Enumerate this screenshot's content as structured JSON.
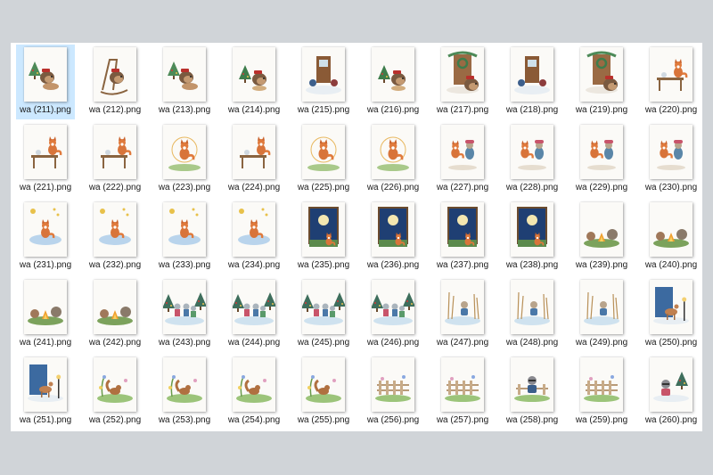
{
  "files": [
    {
      "name": "wa (211).png",
      "subject": "hedgehog-bowl",
      "selected": true
    },
    {
      "name": "wa (212).png",
      "subject": "hedgehog-rocking-chair"
    },
    {
      "name": "wa (213).png",
      "subject": "hedgehog-bowl"
    },
    {
      "name": "wa (214).png",
      "subject": "hedgehog-tree"
    },
    {
      "name": "wa (215).png",
      "subject": "doorway-snow"
    },
    {
      "name": "wa (216).png",
      "subject": "hedgehog-tree"
    },
    {
      "name": "wa (217).png",
      "subject": "doorway-wreath"
    },
    {
      "name": "wa (218).png",
      "subject": "doorway-snow"
    },
    {
      "name": "wa (219).png",
      "subject": "doorway-wreath"
    },
    {
      "name": "wa (220).png",
      "subject": "fox-table"
    },
    {
      "name": "wa (221).png",
      "subject": "fox-table"
    },
    {
      "name": "wa (222).png",
      "subject": "fox-table"
    },
    {
      "name": "wa (223).png",
      "subject": "fox-leaping"
    },
    {
      "name": "wa (224).png",
      "subject": "fox-table"
    },
    {
      "name": "wa (225).png",
      "subject": "fox-leaping"
    },
    {
      "name": "wa (226).png",
      "subject": "fox-leaping"
    },
    {
      "name": "wa (227).png",
      "subject": "animals-pair"
    },
    {
      "name": "wa (228).png",
      "subject": "animals-pair"
    },
    {
      "name": "wa (229).png",
      "subject": "animals-pair"
    },
    {
      "name": "wa (230).png",
      "subject": "animals-pair"
    },
    {
      "name": "wa (231).png",
      "subject": "fox-cloud"
    },
    {
      "name": "wa (232).png",
      "subject": "fox-cloud"
    },
    {
      "name": "wa (233).png",
      "subject": "fox-cloud"
    },
    {
      "name": "wa (234).png",
      "subject": "fox-cloud"
    },
    {
      "name": "wa (235).png",
      "subject": "night-window"
    },
    {
      "name": "wa (236).png",
      "subject": "night-window"
    },
    {
      "name": "wa (237).png",
      "subject": "night-window"
    },
    {
      "name": "wa (238).png",
      "subject": "night-window"
    },
    {
      "name": "wa (239).png",
      "subject": "campfire"
    },
    {
      "name": "wa (240).png",
      "subject": "campfire"
    },
    {
      "name": "wa (241).png",
      "subject": "campfire"
    },
    {
      "name": "wa (242).png",
      "subject": "campfire"
    },
    {
      "name": "wa (243).png",
      "subject": "skating-group"
    },
    {
      "name": "wa (244).png",
      "subject": "skating-group"
    },
    {
      "name": "wa (245).png",
      "subject": "skating-group"
    },
    {
      "name": "wa (246).png",
      "subject": "skating-group"
    },
    {
      "name": "wa (247).png",
      "subject": "skater-reeds"
    },
    {
      "name": "wa (248).png",
      "subject": "skater-reeds"
    },
    {
      "name": "wa (249).png",
      "subject": "skater-reeds"
    },
    {
      "name": "wa (250).png",
      "subject": "deer-lamp"
    },
    {
      "name": "wa (251).png",
      "subject": "deer-lamp"
    },
    {
      "name": "wa (252).png",
      "subject": "squirrel-flowers"
    },
    {
      "name": "wa (253).png",
      "subject": "squirrel-flowers"
    },
    {
      "name": "wa (254).png",
      "subject": "squirrel-flowers"
    },
    {
      "name": "wa (255).png",
      "subject": "squirrel-flowers"
    },
    {
      "name": "wa (256).png",
      "subject": "fence-garden"
    },
    {
      "name": "wa (257).png",
      "subject": "fence-garden"
    },
    {
      "name": "wa (258).png",
      "subject": "raccoon-fence"
    },
    {
      "name": "wa (259).png",
      "subject": "fence-garden"
    },
    {
      "name": "wa (260).png",
      "subject": "raccoon-tree"
    }
  ]
}
